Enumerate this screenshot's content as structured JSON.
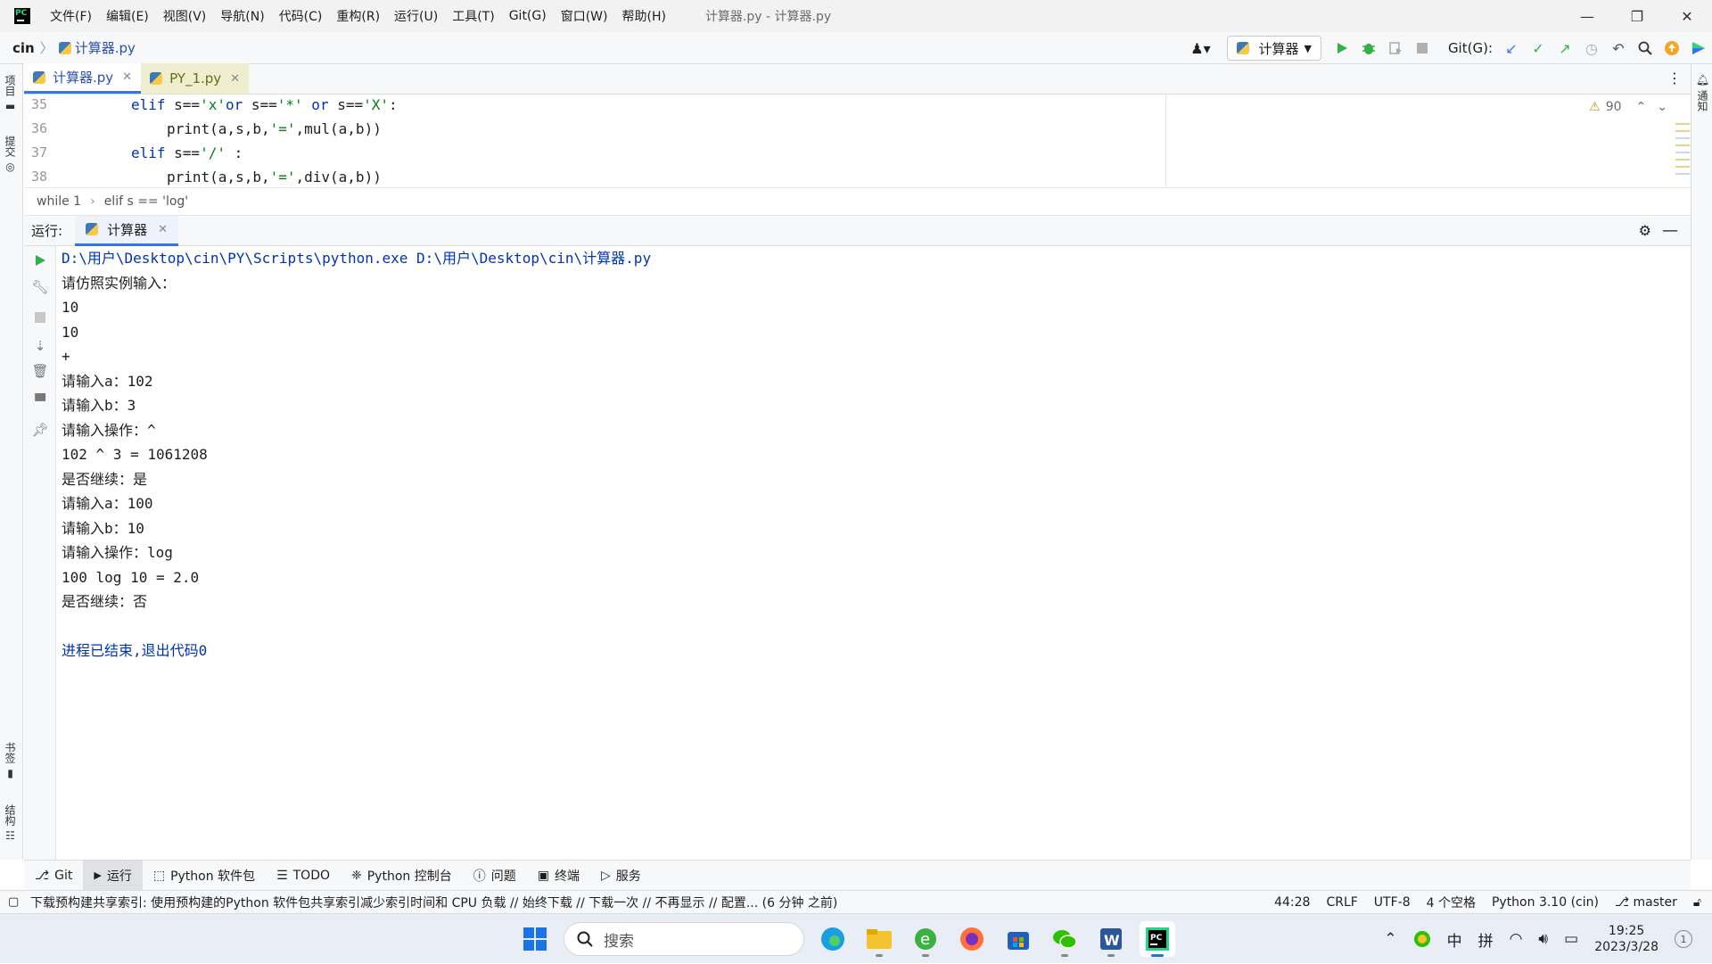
{
  "menubar": {
    "items": [
      "文件(F)",
      "编辑(E)",
      "视图(V)",
      "导航(N)",
      "代码(C)",
      "重构(R)",
      "运行(U)",
      "工具(T)",
      "Git(G)",
      "窗口(W)",
      "帮助(H)"
    ],
    "window_title": "计算器.py - 计算器.py"
  },
  "navbar": {
    "root": "cin",
    "file": "计算器.py",
    "run_config": "计算器",
    "git_label": "Git(G):"
  },
  "tabs": [
    {
      "label": "计算器.py",
      "active": true
    },
    {
      "label": "PY_1.py",
      "active": false
    }
  ],
  "editor": {
    "warning_count": "90",
    "lines": [
      {
        "num": "35"
      },
      {
        "num": "36"
      },
      {
        "num": "37"
      },
      {
        "num": "38"
      }
    ],
    "code": {
      "l35_kw": "elif",
      "l35_a": " s==",
      "l35_s1": "'x'",
      "l35_or1": "or",
      "l35_b": " s==",
      "l35_s2": "'*'",
      "l35_or2": " or",
      "l35_c": " s==",
      "l35_s3": "'X'",
      "l35_end": ":",
      "l36_a": "print(a,s,b,",
      "l36_s": "'='",
      "l36_b": ",mul(a,b))",
      "l37_kw": "elif",
      "l37_a": " s==",
      "l37_s": "'/'",
      "l37_end": " :",
      "l38_a": "print(a,s,b,",
      "l38_s": "'='",
      "l38_b": ",div(a,b))"
    }
  },
  "breadcrumbs": [
    "while 1",
    "elif s == 'log'"
  ],
  "run_panel": {
    "label": "运行:",
    "tab": "计算器",
    "console": [
      "D:\\用户\\Desktop\\cin\\PY\\Scripts\\python.exe D:\\用户\\Desktop\\cin\\计算器.py",
      "请仿照实例输入：",
      "10",
      "10",
      "+",
      "请输入a：102",
      "请输入b：3",
      "请输入操作：^",
      "102 ^ 3 = 1061208",
      "是否继续：是",
      "请输入a：100",
      "请输入b：10",
      "请输入操作：log",
      "100 log 10 = 2.0",
      "是否继续：否",
      "",
      "进程已结束,退出代码0"
    ]
  },
  "left_tools": [
    "项目",
    "提交",
    "书签",
    "结构"
  ],
  "right_tools": [
    "通知"
  ],
  "tool_windows": [
    {
      "label": "Git",
      "icon": "git-branch-icon"
    },
    {
      "label": "运行",
      "icon": "run-icon"
    },
    {
      "label": "Python 软件包",
      "icon": "layers-icon"
    },
    {
      "label": "TODO",
      "icon": "list-icon"
    },
    {
      "label": "Python 控制台",
      "icon": "python-console-icon"
    },
    {
      "label": "问题",
      "icon": "info-icon"
    },
    {
      "label": "终端",
      "icon": "terminal-icon"
    },
    {
      "label": "服务",
      "icon": "services-icon"
    }
  ],
  "statusbar": {
    "message": "下载预构建共享索引: 使用预构建的Python 软件包共享索引减少索引时间和 CPU 负载 // 始终下载 // 下载一次 // 不再显示 // 配置... (6 分钟 之前)",
    "position": "44:28",
    "line_sep": "CRLF",
    "encoding": "UTF-8",
    "indent": "4 个空格",
    "interpreter": "Python 3.10 (cin)",
    "branch": "master"
  },
  "taskbar": {
    "search_placeholder": "搜索",
    "ime_lang": "中",
    "ime_mode": "拼",
    "time": "19:25",
    "date": "2023/3/28",
    "notif_count": "1"
  },
  "colors": {
    "accent": "#3574f0",
    "keyword": "#0033b3",
    "string": "#067d17",
    "run_green": "#2fb344"
  }
}
